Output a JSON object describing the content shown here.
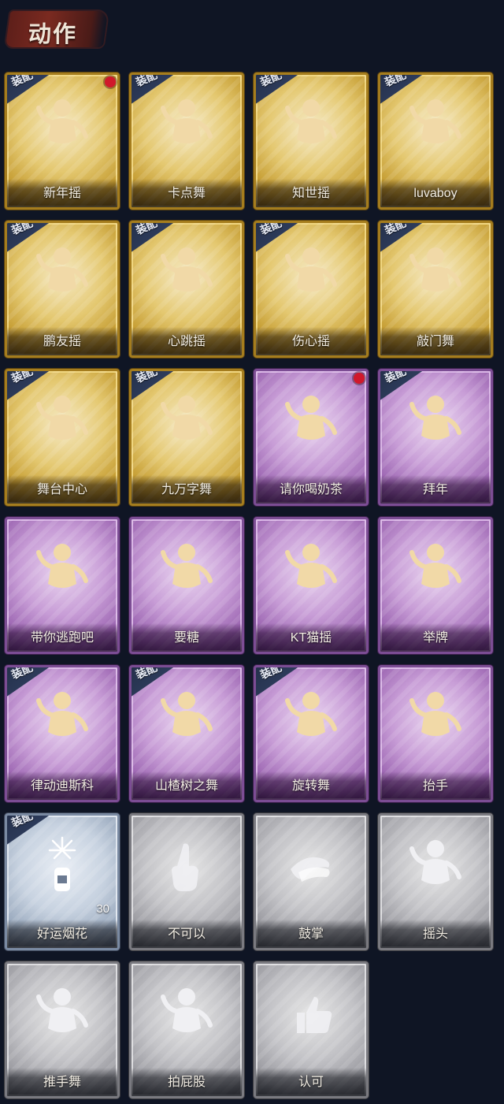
{
  "header": {
    "title": "动作"
  },
  "badge_label": "装配",
  "colors": {
    "gold": "#c39a2e",
    "purple": "#9a63b0",
    "blue": "#96a6bb",
    "gray": "#98989e",
    "new_dot": "#d0182b"
  },
  "cards": [
    {
      "label": "新年摇",
      "tier": "gold",
      "equipped": true,
      "new": true,
      "icon": "waving-figure-icon"
    },
    {
      "label": "卡点舞",
      "tier": "gold",
      "equipped": true,
      "new": false,
      "icon": "pointing-dance-icon"
    },
    {
      "label": "知世摇",
      "tier": "gold",
      "equipped": true,
      "new": false,
      "icon": "music-dance-icon"
    },
    {
      "label": "luvaboy",
      "tier": "gold",
      "equipped": true,
      "new": false,
      "icon": "arm-cross-dance-icon"
    },
    {
      "label": "鹏友摇",
      "tier": "gold",
      "equipped": true,
      "new": false,
      "icon": "shrug-figure-icon"
    },
    {
      "label": "心跳摇",
      "tier": "gold",
      "equipped": true,
      "new": false,
      "icon": "hand-raise-icon"
    },
    {
      "label": "伤心摇",
      "tier": "gold",
      "equipped": true,
      "new": false,
      "icon": "heart-hands-icon"
    },
    {
      "label": "敲门舞",
      "tier": "gold",
      "equipped": true,
      "new": false,
      "icon": "knock-figure-icon"
    },
    {
      "label": "舞台中心",
      "tier": "gold",
      "equipped": true,
      "new": false,
      "icon": "sparkle-figure-icon"
    },
    {
      "label": "九万字舞",
      "tier": "gold",
      "equipped": true,
      "new": false,
      "icon": "swirl-figure-icon"
    },
    {
      "label": "请你喝奶茶",
      "tier": "purple",
      "equipped": false,
      "new": true,
      "icon": "sign-figure-icon"
    },
    {
      "label": "拜年",
      "tier": "purple",
      "equipped": true,
      "new": false,
      "icon": "bow-figure-icon"
    },
    {
      "label": "带你逃跑吧",
      "tier": "purple",
      "equipped": false,
      "new": false,
      "icon": "run-figure-icon"
    },
    {
      "label": "要糖",
      "tier": "purple",
      "equipped": false,
      "new": false,
      "icon": "reach-figure-icon"
    },
    {
      "label": "KT猫摇",
      "tier": "purple",
      "equipped": false,
      "new": false,
      "icon": "cat-dance-icon"
    },
    {
      "label": "举牌",
      "tier": "purple",
      "equipped": false,
      "new": false,
      "icon": "hold-sign-icon"
    },
    {
      "label": "律动迪斯科",
      "tier": "purple",
      "equipped": true,
      "new": false,
      "icon": "disco-figure-icon"
    },
    {
      "label": "山楂树之舞",
      "tier": "purple",
      "equipped": true,
      "new": false,
      "icon": "arm-up-figure-icon"
    },
    {
      "label": "旋转舞",
      "tier": "purple",
      "equipped": true,
      "new": false,
      "icon": "spin-figure-icon"
    },
    {
      "label": "抬手",
      "tier": "purple",
      "equipped": false,
      "new": false,
      "icon": "lift-hand-icon"
    },
    {
      "label": "好运烟花",
      "tier": "blue",
      "equipped": true,
      "new": false,
      "icon": "firework-icon",
      "count": "30"
    },
    {
      "label": "不可以",
      "tier": "gray",
      "equipped": false,
      "new": false,
      "icon": "finger-wag-icon"
    },
    {
      "label": "鼓掌",
      "tier": "gray",
      "equipped": false,
      "new": false,
      "icon": "clap-icon"
    },
    {
      "label": "摇头",
      "tier": "gray",
      "equipped": false,
      "new": false,
      "icon": "head-shake-icon"
    },
    {
      "label": "推手舞",
      "tier": "gray",
      "equipped": false,
      "new": false,
      "icon": "push-hands-icon"
    },
    {
      "label": "拍屁股",
      "tier": "gray",
      "equipped": false,
      "new": false,
      "icon": "pat-figure-icon"
    },
    {
      "label": "认可",
      "tier": "gray",
      "equipped": false,
      "new": false,
      "icon": "thumbs-up-icon"
    }
  ]
}
